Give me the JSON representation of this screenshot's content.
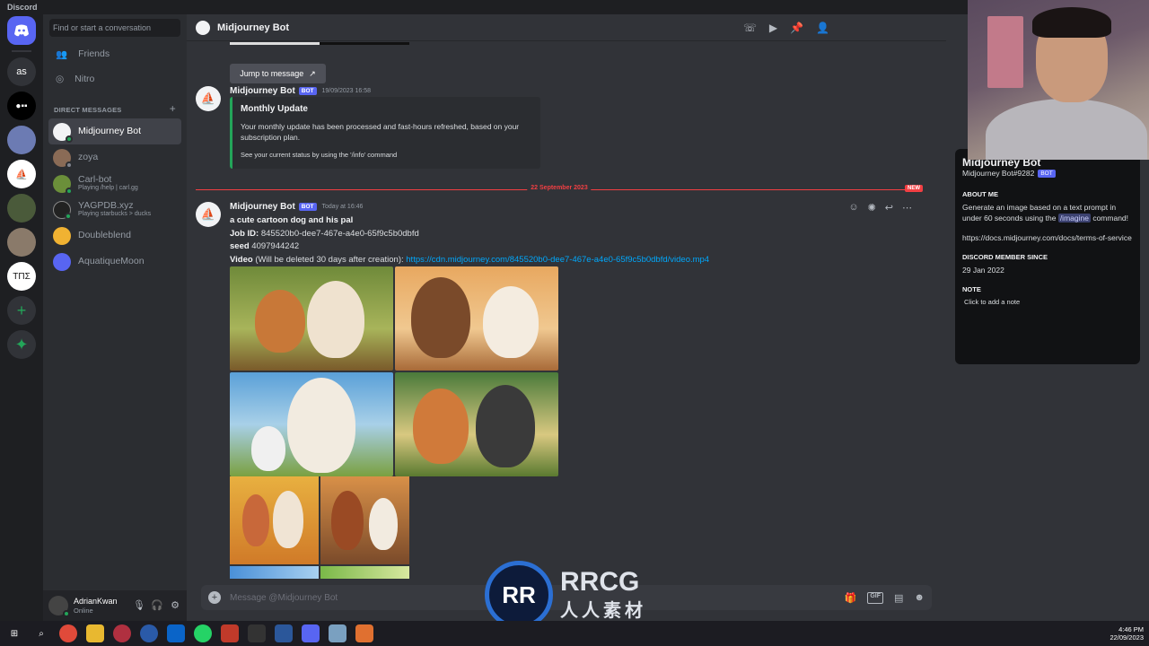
{
  "app": {
    "title": "Discord"
  },
  "servers": [
    {
      "label": "as"
    },
    {
      "label": "TΠΣ"
    }
  ],
  "dm_column": {
    "search_placeholder": "Find or start a conversation",
    "nav": [
      {
        "label": "Friends",
        "icon": "friends-icon"
      },
      {
        "label": "Nitro",
        "icon": "nitro-icon"
      }
    ],
    "header": "DIRECT MESSAGES",
    "dms": [
      {
        "name": "Midjourney Bot",
        "sub": "",
        "active": true,
        "color": "#f2f3f5"
      },
      {
        "name": "zoya",
        "sub": "",
        "color": "#8a6b56"
      },
      {
        "name": "Carl-bot",
        "sub": "Playing /help | carl.gg",
        "color": "#6b8f3a"
      },
      {
        "name": "YAGPDB.xyz",
        "sub": "Playing starbucks > ducks",
        "color": "#222222"
      },
      {
        "name": "Doubleblend",
        "sub": "",
        "color": "#f0b232"
      },
      {
        "name": "AquatiqueMoon",
        "sub": "",
        "color": "#5865f2"
      }
    ],
    "user": {
      "name": "AdrianKwan",
      "status": "Online"
    }
  },
  "chat": {
    "title": "Midjourney Bot",
    "jump_label": "Jump to message",
    "msg1": {
      "author": "Midjourney Bot",
      "bot": "BOT",
      "time": "19/09/2023 16:58",
      "embed_title": "Monthly Update",
      "embed_body": "Your monthly update has been processed and fast-hours refreshed, based on your subscription plan.",
      "embed_footer": "See your current status by using the '/info' command"
    },
    "divider": {
      "date": "22 September 2023",
      "new": "NEW"
    },
    "msg2": {
      "author": "Midjourney Bot",
      "bot": "BOT",
      "time": "Today at 16:46",
      "prompt": "a cute cartoon dog and his pal",
      "job_label": "Job ID:",
      "job_id": "845520b0-dee7-467e-a4e0-65f9c5b0dbfd",
      "seed_label": "seed",
      "seed": "4097944242",
      "video_label": "Video",
      "video_note": "(Will be deleted 30 days after creation):",
      "video_url": "https://cdn.midjourney.com/845520b0-dee7-467e-a4e0-65f9c5b0dbfd/video.mp4"
    },
    "composer_placeholder": "Message @Midjourney Bot"
  },
  "profile": {
    "name": "Midjourney Bot",
    "tag": "Midjourney Bot#9282",
    "bot": "BOT",
    "about_label": "ABOUT ME",
    "about_pre": "Generate an image based on a text prompt in under 60 seconds using the",
    "about_cmd": "/imagine",
    "about_post": "command!",
    "link": "https://docs.midjourney.com/docs/terms-of-service",
    "since_label": "DISCORD MEMBER SINCE",
    "since": "29 Jan 2022",
    "note_label": "NOTE",
    "note_placeholder": "Click to add a note"
  },
  "taskbar": {
    "time": "4:46 PM",
    "date": "22/09/2023"
  },
  "watermark": {
    "brand": "RRCG",
    "sub": "人人素材",
    "mark": "RR"
  }
}
